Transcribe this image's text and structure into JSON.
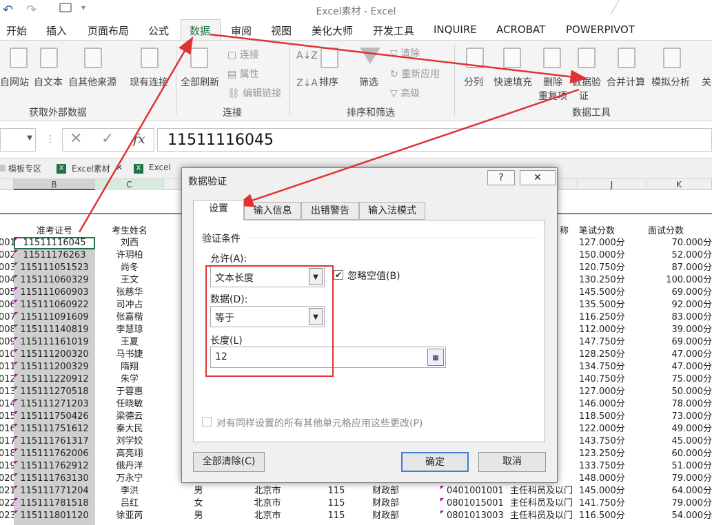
{
  "window": {
    "title": "Excel素材 - Excel"
  },
  "menu_tabs": [
    "开始",
    "插入",
    "页面布局",
    "公式",
    "数据",
    "审阅",
    "视图",
    "美化大师",
    "开发工具",
    "INQUIRE",
    "ACROBAT",
    "POWERPIVOT"
  ],
  "ribbon": {
    "ext_buttons": [
      "自网站",
      "自文本",
      "自其他来源",
      "现有连接"
    ],
    "refresh": "全部刷新",
    "conn_items": [
      "连接",
      "属性",
      "编辑链接"
    ],
    "sort_buttons": [
      "排序",
      "筛选"
    ],
    "filter_items": [
      "清除",
      "重新应用",
      "高级"
    ],
    "tool_buttons": [
      "分列",
      "快速填充",
      "删除",
      "数据验",
      "合并计算",
      "模拟分析",
      "关"
    ],
    "tool_second": [
      "重复项",
      "证"
    ],
    "groups": [
      "获取外部数据",
      "连接",
      "排序和筛选",
      "数据工具"
    ]
  },
  "formula": {
    "fx": "fx",
    "value": "11511116045"
  },
  "doc_tabs": [
    "模板专区",
    "Excel素材",
    "Excel"
  ],
  "columns": {
    "left": [
      "B",
      "C"
    ],
    "right": [
      "J",
      "K"
    ]
  },
  "headers": {
    "b": "准考证号",
    "c": "考生姓名",
    "i": "称",
    "j": "笔试分数",
    "k": "面试分数"
  },
  "rows": [
    {
      "a": "001",
      "b": "11511116045",
      "c": "刘西",
      "i": "以门",
      "j": "127.000分",
      "k": "70.000分"
    },
    {
      "a": "002",
      "b": "11511176263",
      "c": "许玥柏",
      "i": "以门",
      "j": "150.000分",
      "k": "52.000分"
    },
    {
      "a": "003",
      "b": "115111051523",
      "c": "尚冬",
      "i": "以门",
      "j": "120.750分",
      "k": "87.000分"
    },
    {
      "a": "004",
      "b": "115111060329",
      "c": "王文",
      "i": "以门",
      "j": "130.250分",
      "k": "100.000分"
    },
    {
      "a": "005",
      "b": "115111060903",
      "c": "张慈华",
      "i": "以门",
      "j": "145.500分",
      "k": "69.000分"
    },
    {
      "a": "006",
      "b": "115111060922",
      "c": "司冲占",
      "i": "以门",
      "j": "135.500分",
      "k": "92.000分"
    },
    {
      "a": "007",
      "b": "115111091609",
      "c": "张嘉楷",
      "i": "以门",
      "j": "116.250分",
      "k": "83.000分"
    },
    {
      "a": "008",
      "b": "115111140819",
      "c": "李慧琼",
      "i": "以门",
      "j": "112.000分",
      "k": "39.000分"
    },
    {
      "a": "009",
      "b": "115111161019",
      "c": "王夏",
      "i": "以门",
      "j": "147.750分",
      "k": "69.000分"
    },
    {
      "a": "010",
      "b": "115111200320",
      "c": "马书婕",
      "i": "以门",
      "j": "128.250分",
      "k": "47.000分"
    },
    {
      "a": "011",
      "b": "115111200329",
      "c": "隋翔",
      "i": "以门",
      "j": "134.750分",
      "k": "47.000分"
    },
    {
      "a": "012",
      "b": "115111220912",
      "c": "朱学",
      "i": "以门",
      "j": "140.750分",
      "k": "75.000分"
    },
    {
      "a": "013",
      "b": "115111270518",
      "c": "于蓉惠",
      "i": "以门",
      "j": "127.000分",
      "k": "50.000分"
    },
    {
      "a": "014",
      "b": "115111271203",
      "c": "任晓敏",
      "i": "以门",
      "j": "146.000分",
      "k": "78.000分"
    },
    {
      "a": "015",
      "b": "115111750426",
      "c": "梁德云",
      "i": "以门",
      "j": "118.500分",
      "k": "73.000分"
    },
    {
      "a": "016",
      "b": "115111751612",
      "c": "秦大民",
      "i": "以门",
      "j": "122.000分",
      "k": "49.000分"
    },
    {
      "a": "017",
      "b": "115111761317",
      "c": "刘学姣",
      "i": "以门",
      "j": "143.750分",
      "k": "45.000分"
    },
    {
      "a": "018",
      "b": "115111762006",
      "c": "高亮翊",
      "i": "以门",
      "j": "123.250分",
      "k": "60.000分"
    },
    {
      "a": "019",
      "b": "115111762912",
      "c": "俄丹洋",
      "i": "以门",
      "j": "133.750分",
      "k": "51.000分"
    },
    {
      "a": "020",
      "b": "115111763130",
      "c": "万永宁",
      "i": "以门",
      "j": "148.000分",
      "k": "79.000分"
    },
    {
      "a": "021",
      "b": "115111771204",
      "c": "李洪",
      "d": "男",
      "e": "北京市",
      "f": "115",
      "g": "财政部",
      "h": "0401001001",
      "i": "主任科员及以门",
      "j": "145.000分",
      "k": "64.000分"
    },
    {
      "a": "022",
      "b": "115111781518",
      "c": "吕红",
      "d": "女",
      "e": "北京市",
      "f": "115",
      "g": "财政部",
      "h": "0801015001",
      "i": "主任科员及以门",
      "j": "141.750分",
      "k": "79.000分"
    },
    {
      "a": "023",
      "b": "115111801120",
      "c": "徐亚芮",
      "d": "男",
      "e": "北京市",
      "f": "115",
      "g": "财政部",
      "h": "0801013003",
      "i": "主任科员及以门",
      "j": "116.500分",
      "k": "54.000分"
    }
  ],
  "dialog": {
    "title": "数据验证",
    "help": "?",
    "close": "✕",
    "tabs": [
      "设置",
      "输入信息",
      "出错警告",
      "输入法模式"
    ],
    "section": "验证条件",
    "allow_label": "允许(A):",
    "allow_value": "文本长度",
    "ignore_blank": "忽略空值(B)",
    "data_label": "数据(D):",
    "data_value": "等于",
    "length_label": "长度(L)",
    "length_value": "12",
    "apply_all": "对有同样设置的所有其他单元格应用这些更改(P)",
    "clear_all": "全部清除(C)",
    "ok": "确定",
    "cancel": "取消"
  },
  "colors": {
    "accent": "#217346",
    "annotation": "#e03232"
  }
}
